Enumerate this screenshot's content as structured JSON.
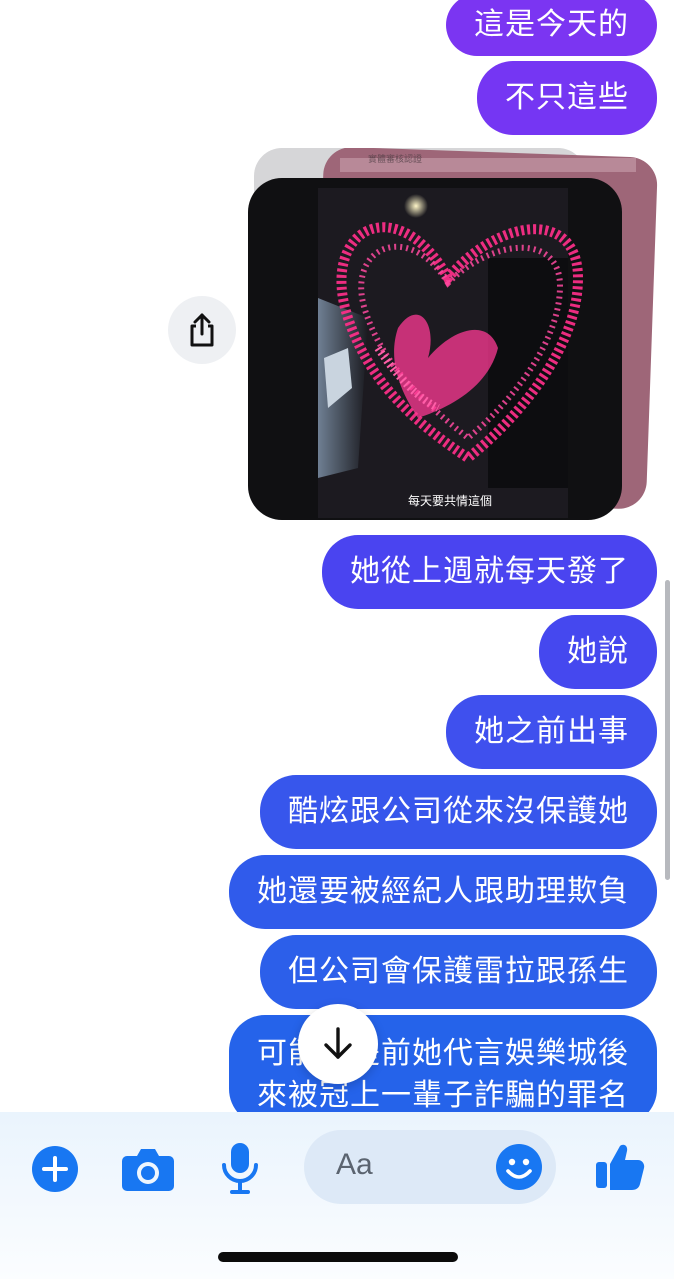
{
  "messages": [
    {
      "text": "這是今天的",
      "color": "#7b35f2"
    },
    {
      "text": "不只這些",
      "color": "#7536f3"
    },
    {
      "text": "她從上週就每天發了",
      "color": "#4a44f0"
    },
    {
      "text": "她說",
      "color": "#4548ef"
    },
    {
      "text": "她之前出事",
      "color": "#3f50ee"
    },
    {
      "text": "酷炫跟公司從來沒保護她",
      "color": "#3756ec"
    },
    {
      "text": "她還要被經紀人跟助理欺負",
      "color": "#305beb"
    },
    {
      "text": "但公司會保護雷拉跟孫生",
      "color": "#2c5fea"
    },
    {
      "text": "可能就是前她代言娛樂城後\n來被冠上一輩子詐騙的罪名",
      "color": "#2563ea"
    }
  ],
  "media": {
    "caption": "每天要共情這個",
    "top_caption": "實體審核認證"
  },
  "composer": {
    "placeholder": "Aa",
    "accent": "#1877f2"
  },
  "icons": {
    "share": "share-icon",
    "down": "arrow-down-icon",
    "plus": "plus-icon",
    "camera": "camera-icon",
    "mic": "microphone-icon",
    "emoji": "emoji-icon",
    "like": "thumbs-up-icon"
  }
}
